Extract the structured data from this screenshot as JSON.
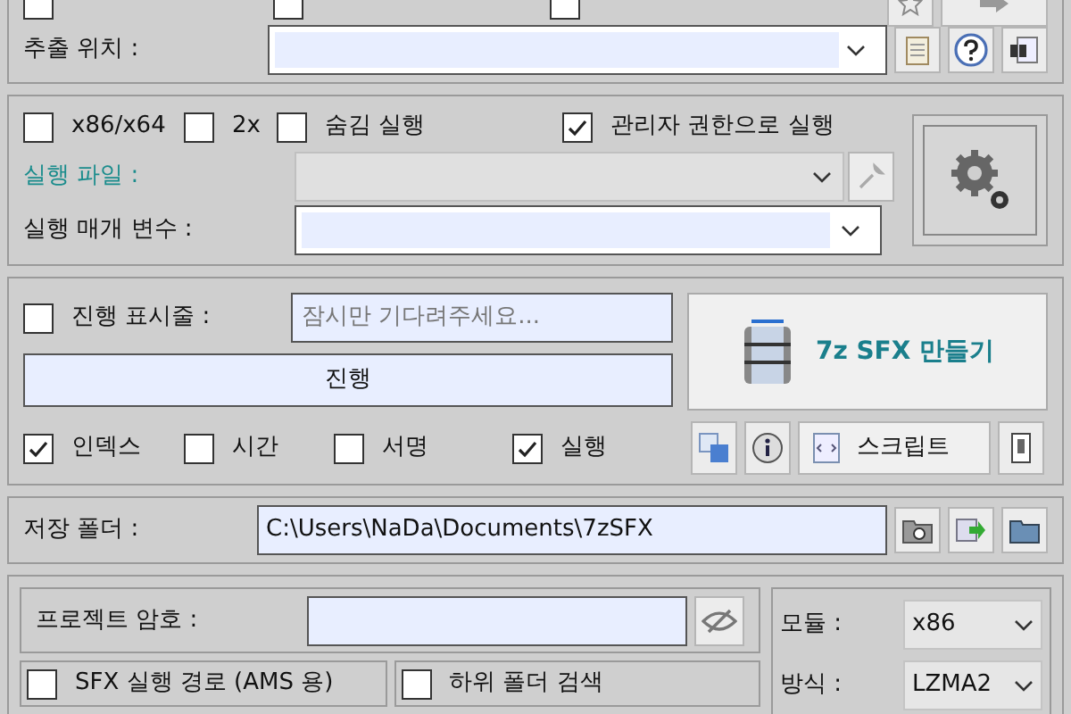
{
  "top_row": {
    "checkboxes": [
      {
        "checked": false
      },
      {
        "checked": false
      },
      {
        "checked": false
      }
    ]
  },
  "extract_location": {
    "label": "추출 위치 :"
  },
  "run_options": {
    "checkboxes": [
      {
        "label": "x86/x64",
        "checked": false
      },
      {
        "label": "2x",
        "checked": false
      },
      {
        "label": "숨김 실행",
        "checked": false
      },
      {
        "label": "관리자 권한으로 실행",
        "checked": true
      }
    ],
    "exe_label": "실행 파일 :",
    "exe_disabled": true,
    "params_label": "실행 매개 변수 :"
  },
  "progress": {
    "checkbox": {
      "label": "진행 표시줄 :",
      "checked": false
    },
    "message": "잠시만 기다려주세요...",
    "bar_label": "진행",
    "make_button": "7z SFX 만들기",
    "checkboxes": [
      {
        "label": "인덱스",
        "checked": true
      },
      {
        "label": "시간",
        "checked": false
      },
      {
        "label": "서명",
        "checked": false
      },
      {
        "label": "실행",
        "checked": true
      }
    ],
    "script_button": "스크립트"
  },
  "save_folder": {
    "label": "저장 폴더 :",
    "value": "C:\\Users\\NaDa\\Documents\\7zSFX"
  },
  "project": {
    "password_label": "프로젝트 암호 :",
    "checkboxes": [
      {
        "label": "SFX 실행 경로 (AMS 용)",
        "checked": false
      },
      {
        "label": "하위 폴더 검색",
        "checked": false
      }
    ],
    "module": {
      "label": "모듈 :",
      "value": "x86"
    },
    "method": {
      "label": "방식 :",
      "value": "LZMA2"
    }
  }
}
